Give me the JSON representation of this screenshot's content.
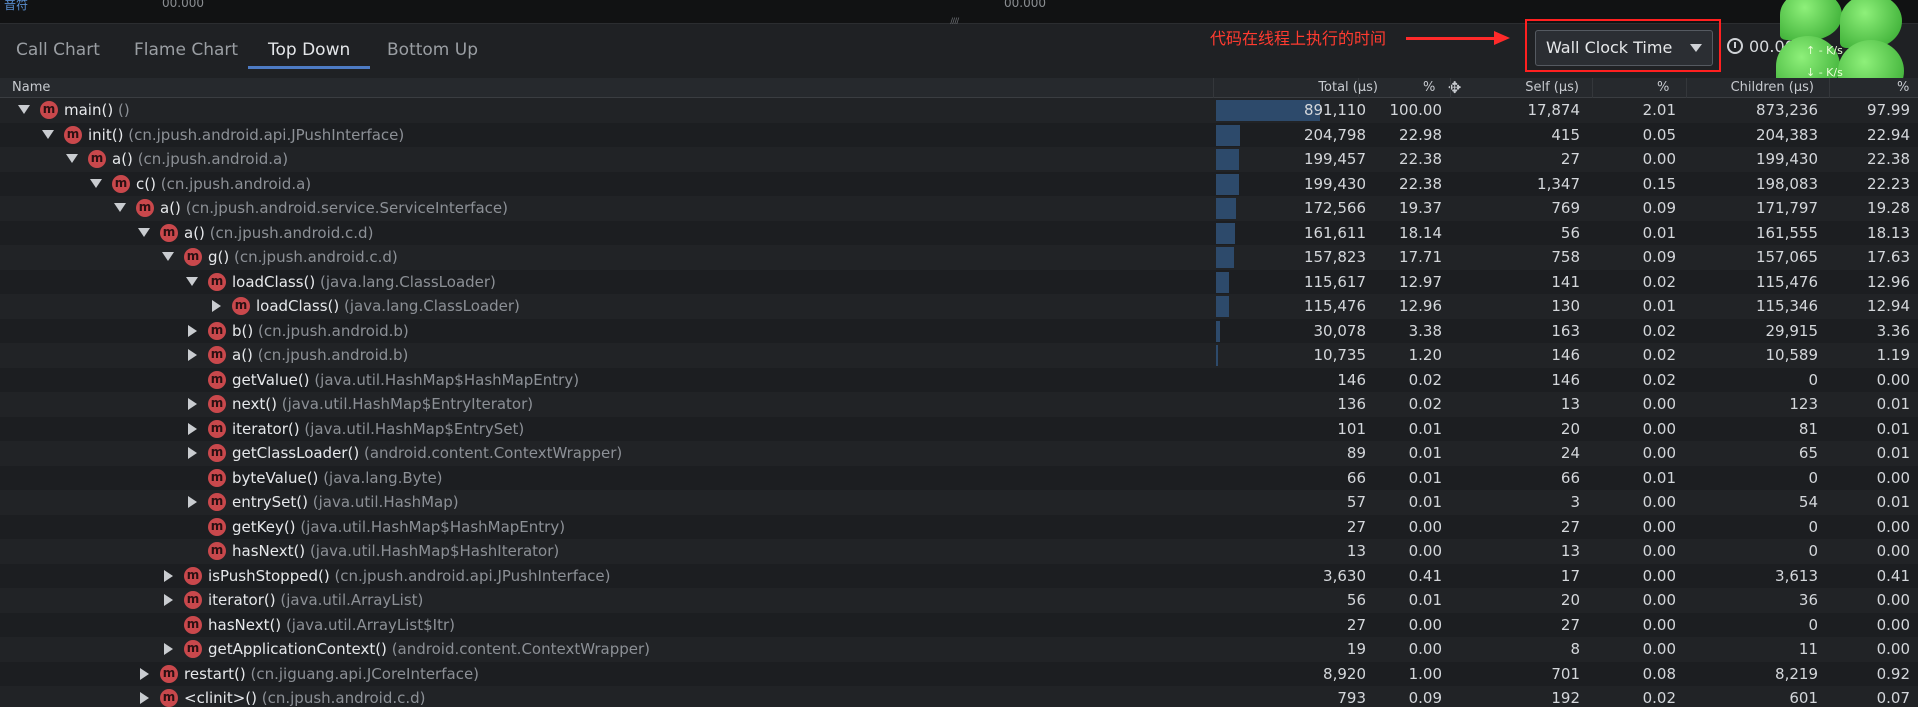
{
  "timeline": {
    "left_label": "音符",
    "tick1": "00.000",
    "tick2": "00.000",
    "grip": "////"
  },
  "tabs": [
    {
      "label": "Call Chart",
      "active": false
    },
    {
      "label": "Flame Chart",
      "active": false
    },
    {
      "label": "Top Down",
      "active": true
    },
    {
      "label": "Bottom Up",
      "active": false
    }
  ],
  "annotation": "代码在线程上执行的时间",
  "clock_select": {
    "value": "Wall Clock Time"
  },
  "range_label": "00.000",
  "widget": {
    "up_rate": "↑ - K/s",
    "down_rate": "↓ - K/s"
  },
  "columns": {
    "name": "Name",
    "total": "Total (µs)",
    "total_pct": "%",
    "self": "Self (µs)",
    "self_pct": "%",
    "children": "Children (µs)",
    "children_pct": "%"
  },
  "colors": {
    "accent": "#4d7bc4",
    "method_icon": "#c9484c",
    "annotation": "#ff3b30"
  },
  "rows": [
    {
      "depth": 0,
      "toggle": "open",
      "method": "main()",
      "cls": "()",
      "total": "891,110",
      "total_pct": "100.00",
      "self": "17,874",
      "self_pct": "2.01",
      "children": "873,236",
      "children_pct": "97.99",
      "bar": 1.0
    },
    {
      "depth": 1,
      "toggle": "open",
      "method": "init()",
      "cls": "(cn.jpush.android.api.JPushInterface)",
      "total": "204,798",
      "total_pct": "22.98",
      "self": "415",
      "self_pct": "0.05",
      "children": "204,383",
      "children_pct": "22.94",
      "bar": 0.2298
    },
    {
      "depth": 2,
      "toggle": "open",
      "method": "a()",
      "cls": "(cn.jpush.android.a)",
      "total": "199,457",
      "total_pct": "22.38",
      "self": "27",
      "self_pct": "0.00",
      "children": "199,430",
      "children_pct": "22.38",
      "bar": 0.2238
    },
    {
      "depth": 3,
      "toggle": "open",
      "method": "c()",
      "cls": "(cn.jpush.android.a)",
      "total": "199,430",
      "total_pct": "22.38",
      "self": "1,347",
      "self_pct": "0.15",
      "children": "198,083",
      "children_pct": "22.23",
      "bar": 0.2238
    },
    {
      "depth": 4,
      "toggle": "open",
      "method": "a()",
      "cls": "(cn.jpush.android.service.ServiceInterface)",
      "total": "172,566",
      "total_pct": "19.37",
      "self": "769",
      "self_pct": "0.09",
      "children": "171,797",
      "children_pct": "19.28",
      "bar": 0.1937
    },
    {
      "depth": 5,
      "toggle": "open",
      "method": "a()",
      "cls": "(cn.jpush.android.c.d)",
      "total": "161,611",
      "total_pct": "18.14",
      "self": "56",
      "self_pct": "0.01",
      "children": "161,555",
      "children_pct": "18.13",
      "bar": 0.1814
    },
    {
      "depth": 6,
      "toggle": "open",
      "method": "g()",
      "cls": "(cn.jpush.android.c.d)",
      "total": "157,823",
      "total_pct": "17.71",
      "self": "758",
      "self_pct": "0.09",
      "children": "157,065",
      "children_pct": "17.63",
      "bar": 0.1771
    },
    {
      "depth": 7,
      "toggle": "open",
      "method": "loadClass()",
      "cls": "(java.lang.ClassLoader)",
      "total": "115,617",
      "total_pct": "12.97",
      "self": "141",
      "self_pct": "0.02",
      "children": "115,476",
      "children_pct": "12.96",
      "bar": 0.1297
    },
    {
      "depth": 8,
      "toggle": "closed",
      "method": "loadClass()",
      "cls": "(java.lang.ClassLoader)",
      "total": "115,476",
      "total_pct": "12.96",
      "self": "130",
      "self_pct": "0.01",
      "children": "115,346",
      "children_pct": "12.94",
      "bar": 0.1296
    },
    {
      "depth": 7,
      "toggle": "closed",
      "method": "b()",
      "cls": "(cn.jpush.android.b)",
      "total": "30,078",
      "total_pct": "3.38",
      "self": "163",
      "self_pct": "0.02",
      "children": "29,915",
      "children_pct": "3.36",
      "bar": 0.0338
    },
    {
      "depth": 7,
      "toggle": "closed",
      "method": "a()",
      "cls": "(cn.jpush.android.b)",
      "total": "10,735",
      "total_pct": "1.20",
      "self": "146",
      "self_pct": "0.02",
      "children": "10,589",
      "children_pct": "1.19",
      "bar": 0.012
    },
    {
      "depth": 7,
      "toggle": "none",
      "method": "getValue()",
      "cls": "(java.util.HashMap$HashMapEntry)",
      "total": "146",
      "total_pct": "0.02",
      "self": "146",
      "self_pct": "0.02",
      "children": "0",
      "children_pct": "0.00",
      "bar": 0
    },
    {
      "depth": 7,
      "toggle": "closed",
      "method": "next()",
      "cls": "(java.util.HashMap$EntryIterator)",
      "total": "136",
      "total_pct": "0.02",
      "self": "13",
      "self_pct": "0.00",
      "children": "123",
      "children_pct": "0.01",
      "bar": 0
    },
    {
      "depth": 7,
      "toggle": "closed",
      "method": "iterator()",
      "cls": "(java.util.HashMap$EntrySet)",
      "total": "101",
      "total_pct": "0.01",
      "self": "20",
      "self_pct": "0.00",
      "children": "81",
      "children_pct": "0.01",
      "bar": 0
    },
    {
      "depth": 7,
      "toggle": "closed",
      "method": "getClassLoader()",
      "cls": "(android.content.ContextWrapper)",
      "total": "89",
      "total_pct": "0.01",
      "self": "24",
      "self_pct": "0.00",
      "children": "65",
      "children_pct": "0.01",
      "bar": 0
    },
    {
      "depth": 7,
      "toggle": "none",
      "method": "byteValue()",
      "cls": "(java.lang.Byte)",
      "total": "66",
      "total_pct": "0.01",
      "self": "66",
      "self_pct": "0.01",
      "children": "0",
      "children_pct": "0.00",
      "bar": 0
    },
    {
      "depth": 7,
      "toggle": "closed",
      "method": "entrySet()",
      "cls": "(java.util.HashMap)",
      "total": "57",
      "total_pct": "0.01",
      "self": "3",
      "self_pct": "0.00",
      "children": "54",
      "children_pct": "0.01",
      "bar": 0
    },
    {
      "depth": 7,
      "toggle": "none",
      "method": "getKey()",
      "cls": "(java.util.HashMap$HashMapEntry)",
      "total": "27",
      "total_pct": "0.00",
      "self": "27",
      "self_pct": "0.00",
      "children": "0",
      "children_pct": "0.00",
      "bar": 0
    },
    {
      "depth": 7,
      "toggle": "none",
      "method": "hasNext()",
      "cls": "(java.util.HashMap$HashIterator)",
      "total": "13",
      "total_pct": "0.00",
      "self": "13",
      "self_pct": "0.00",
      "children": "0",
      "children_pct": "0.00",
      "bar": 0
    },
    {
      "depth": 6,
      "toggle": "closed",
      "method": "isPushStopped()",
      "cls": "(cn.jpush.android.api.JPushInterface)",
      "total": "3,630",
      "total_pct": "0.41",
      "self": "17",
      "self_pct": "0.00",
      "children": "3,613",
      "children_pct": "0.41",
      "bar": 0
    },
    {
      "depth": 6,
      "toggle": "closed",
      "method": "iterator()",
      "cls": "(java.util.ArrayList)",
      "total": "56",
      "total_pct": "0.01",
      "self": "20",
      "self_pct": "0.00",
      "children": "36",
      "children_pct": "0.00",
      "bar": 0
    },
    {
      "depth": 6,
      "toggle": "none",
      "method": "hasNext()",
      "cls": "(java.util.ArrayList$Itr)",
      "total": "27",
      "total_pct": "0.00",
      "self": "27",
      "self_pct": "0.00",
      "children": "0",
      "children_pct": "0.00",
      "bar": 0
    },
    {
      "depth": 6,
      "toggle": "closed",
      "method": "getApplicationContext()",
      "cls": "(android.content.ContextWrapper)",
      "total": "19",
      "total_pct": "0.00",
      "self": "8",
      "self_pct": "0.00",
      "children": "11",
      "children_pct": "0.00",
      "bar": 0
    },
    {
      "depth": 5,
      "toggle": "closed",
      "method": "restart()",
      "cls": "(cn.jiguang.api.JCoreInterface)",
      "total": "8,920",
      "total_pct": "1.00",
      "self": "701",
      "self_pct": "0.08",
      "children": "8,219",
      "children_pct": "0.92",
      "bar": 0
    },
    {
      "depth": 5,
      "toggle": "closed",
      "method": "<clinit>()",
      "cls": "(cn.jpush.android.c.d)",
      "total": "793",
      "total_pct": "0.09",
      "self": "192",
      "self_pct": "0.02",
      "children": "601",
      "children_pct": "0.07",
      "bar": 0
    }
  ]
}
